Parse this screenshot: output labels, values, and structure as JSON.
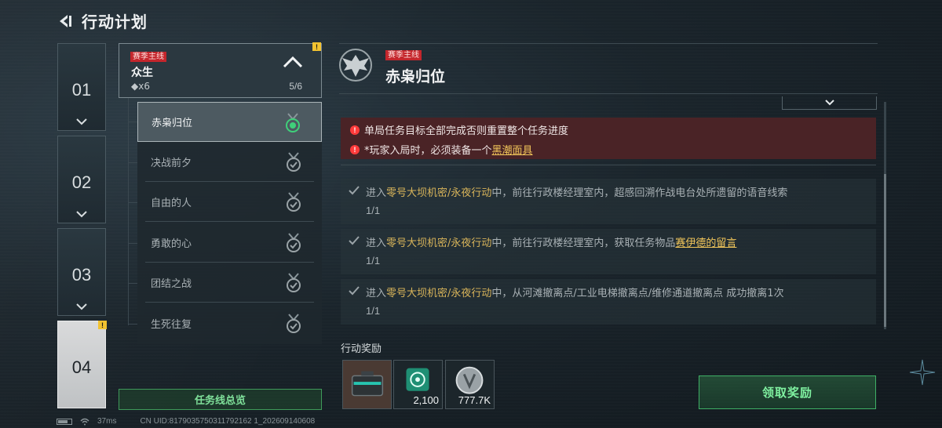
{
  "header": {
    "title": "行动计划",
    "back_icon": "back-arrow-icon"
  },
  "chapters": [
    {
      "num": "01",
      "active": false
    },
    {
      "num": "02",
      "active": false
    },
    {
      "num": "03",
      "active": false
    },
    {
      "num": "04",
      "active": true,
      "badge": "!"
    }
  ],
  "questline": {
    "tag": "赛季主线",
    "name": "众生",
    "count": "◆x6",
    "progress": "5/6",
    "badge": "!"
  },
  "missions": [
    {
      "label": "赤枭归位",
      "selected": true
    },
    {
      "label": "决战前夕",
      "selected": false
    },
    {
      "label": "自由的人",
      "selected": false
    },
    {
      "label": "勇敢的心",
      "selected": false
    },
    {
      "label": "团结之战",
      "selected": false
    },
    {
      "label": "生死往复",
      "selected": false
    }
  ],
  "overview_button": "任务线总览",
  "detail": {
    "tag": "赛季主线",
    "title": "赤枭归位",
    "warnings": {
      "line1": "单局任务目标全部完成否则重置整个任务进度",
      "line2_prefix": "*玩家入局时，必须装备一个",
      "line2_link": "黑潮面具"
    },
    "objectives": [
      {
        "prefix": "进入",
        "location": "零号大坝机密/永夜行动",
        "mid": "中，前往行政楼经理室内，超感回溯作战电台处所遗留的语音线索",
        "item": "",
        "progress": "1/1"
      },
      {
        "prefix": "进入",
        "location": "零号大坝机密/永夜行动",
        "mid": "中，前往行政楼经理室内，获取任务物品",
        "item": "赛伊德的留言",
        "progress": "1/1"
      },
      {
        "prefix": "进入",
        "location": "零号大坝机密/永夜行动",
        "mid": "中，从河滩撤离点/工业电梯撤离点/维修通道撤离点 成功撤离1次",
        "item": "",
        "progress": "1/1"
      }
    ]
  },
  "rewards": {
    "title": "行动奖励",
    "items": [
      {
        "icon": "supply-case-icon",
        "qty": ""
      },
      {
        "icon": "green-emblem-token-icon",
        "qty": "2,100"
      },
      {
        "icon": "silver-coin-icon",
        "qty": "777.7K"
      }
    ]
  },
  "claim_button": "领取奖励",
  "status": {
    "ping": "37ms",
    "uid": "CN UID:8179035750311792162 1_202609140608"
  },
  "colors": {
    "accent_green": "#3fb066",
    "warning_red": "#c4262c",
    "gold": "#f2c65a"
  }
}
